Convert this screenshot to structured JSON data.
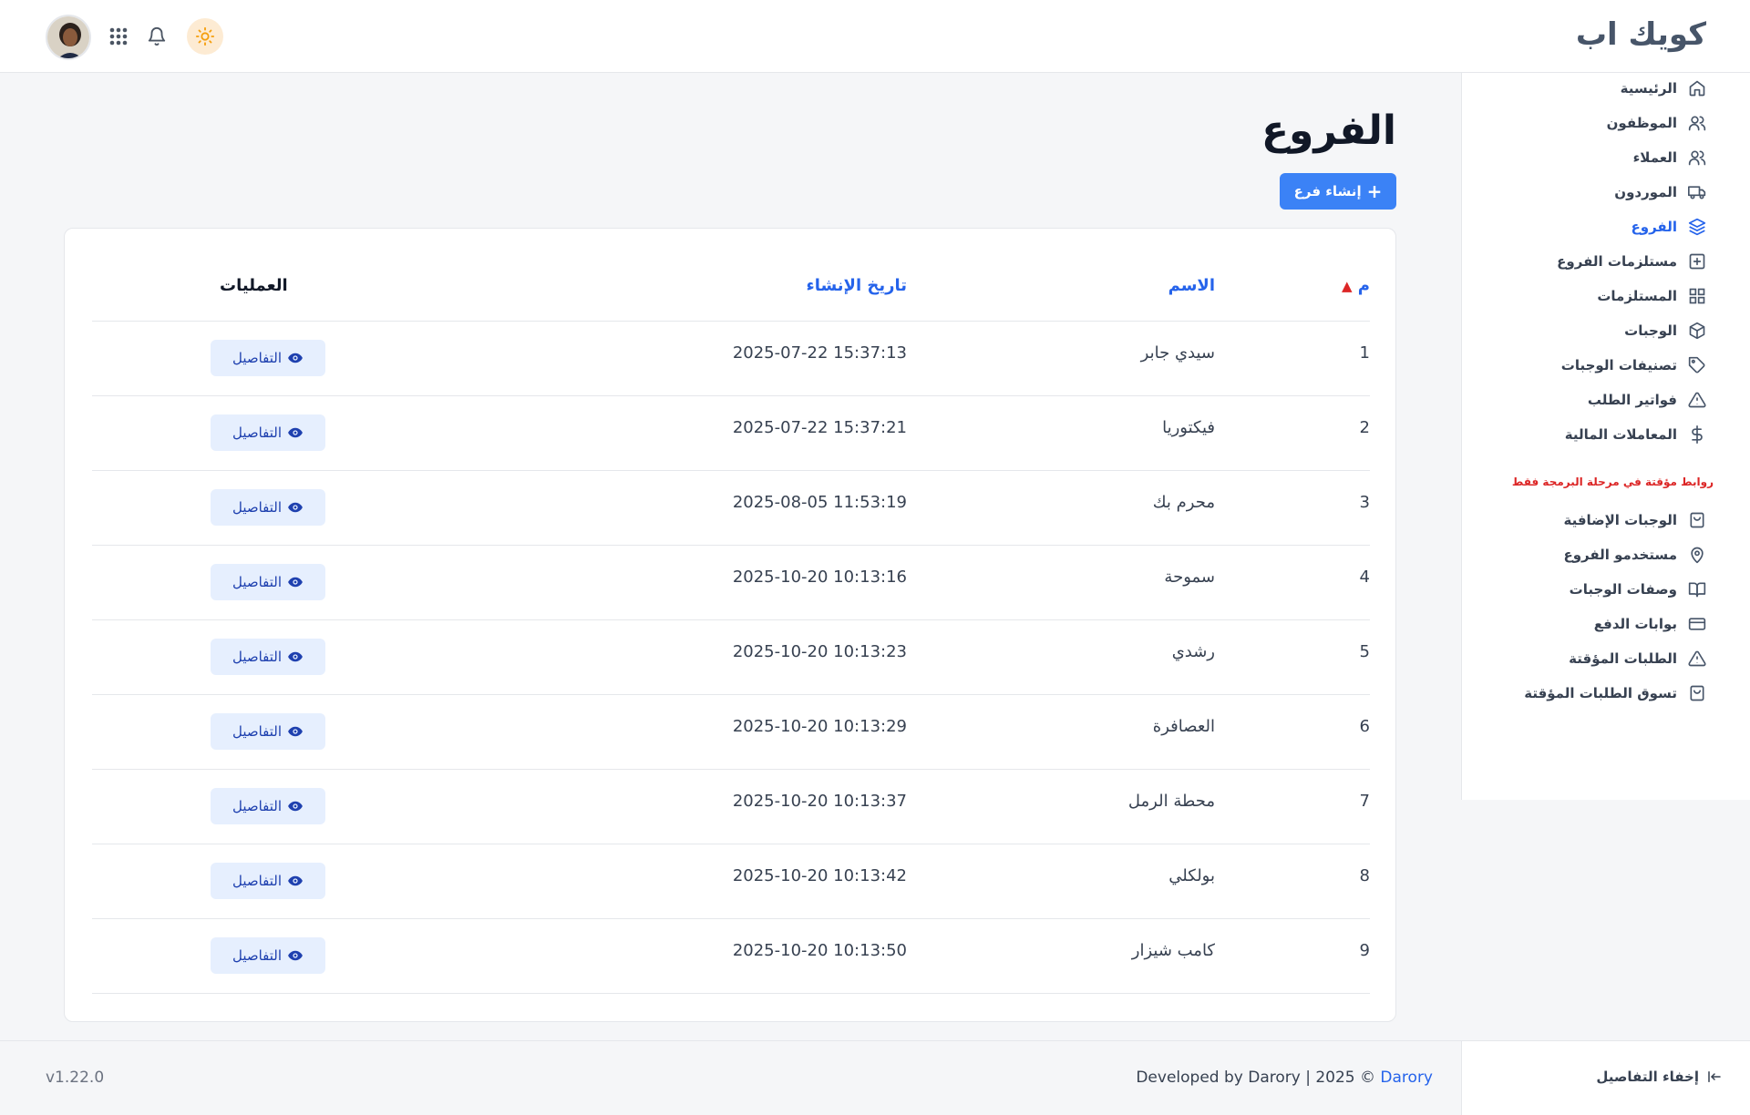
{
  "header": {
    "brand": "كويك اب"
  },
  "sidebar": {
    "items": [
      {
        "label": "الرئيسية",
        "icon": "home-icon"
      },
      {
        "label": "الموظفون",
        "icon": "users-icon"
      },
      {
        "label": "العملاء",
        "icon": "users-icon"
      },
      {
        "label": "الموردون",
        "icon": "truck-icon"
      },
      {
        "label": "الفروع",
        "icon": "layers-icon",
        "active": true
      },
      {
        "label": "مستلزمات الفروع",
        "icon": "plus-square-icon"
      },
      {
        "label": "المستلزمات",
        "icon": "grid-icon"
      },
      {
        "label": "الوجبات",
        "icon": "box-icon"
      },
      {
        "label": "تصنيفات الوجبات",
        "icon": "tag-icon"
      },
      {
        "label": "فواتير الطلب",
        "icon": "alert-triangle-icon"
      },
      {
        "label": "المعاملات المالية",
        "icon": "dollar-icon"
      }
    ],
    "note": "روابط مؤقتة في مرحلة البرمجة فقط",
    "temp_items": [
      {
        "label": "الوجبات الإضافية",
        "icon": "shopping-bag-icon"
      },
      {
        "label": "مستخدمو الفروع",
        "icon": "map-pin-icon"
      },
      {
        "label": "وصفات الوجبات",
        "icon": "book-open-icon"
      },
      {
        "label": "بوابات الدفع",
        "icon": "credit-card-icon"
      },
      {
        "label": "الطلبات المؤقتة",
        "icon": "alert-triangle-icon"
      },
      {
        "label": "تسوق الطلبات المؤقتة",
        "icon": "shopping-bag-icon"
      }
    ]
  },
  "main": {
    "title": "الفروع",
    "create_label": "إنشاء فرع",
    "columns": {
      "index": "م",
      "name": "الاسم",
      "created": "تاريخ الإنشاء",
      "actions": "العمليات"
    },
    "details_label": "التفاصيل",
    "rows": [
      {
        "idx": "1",
        "name": "سيدي جابر",
        "date": "2025-07-22 15:37:13"
      },
      {
        "idx": "2",
        "name": "فيكتوريا",
        "date": "2025-07-22 15:37:21"
      },
      {
        "idx": "3",
        "name": "محرم بك",
        "date": "2025-08-05 11:53:19"
      },
      {
        "idx": "4",
        "name": "سموحة",
        "date": "2025-10-20 10:13:16"
      },
      {
        "idx": "5",
        "name": "رشدي",
        "date": "2025-10-20 10:13:23"
      },
      {
        "idx": "6",
        "name": "العصافرة",
        "date": "2025-10-20 10:13:29"
      },
      {
        "idx": "7",
        "name": "محطة الرمل",
        "date": "2025-10-20 10:13:37"
      },
      {
        "idx": "8",
        "name": "بولكلي",
        "date": "2025-10-20 10:13:42"
      },
      {
        "idx": "9",
        "name": "كامب شيزار",
        "date": "2025-10-20 10:13:50"
      }
    ]
  },
  "footer": {
    "version": "v1.22.0",
    "credit_prefix": "Developed by Darory | 2025 © ",
    "credit_link": "Darory",
    "hide_label": "إخفاء التفاصيل"
  },
  "colors": {
    "accent": "#3b82f6",
    "sort_arrow": "#dc2626",
    "note": "#dc2626"
  }
}
